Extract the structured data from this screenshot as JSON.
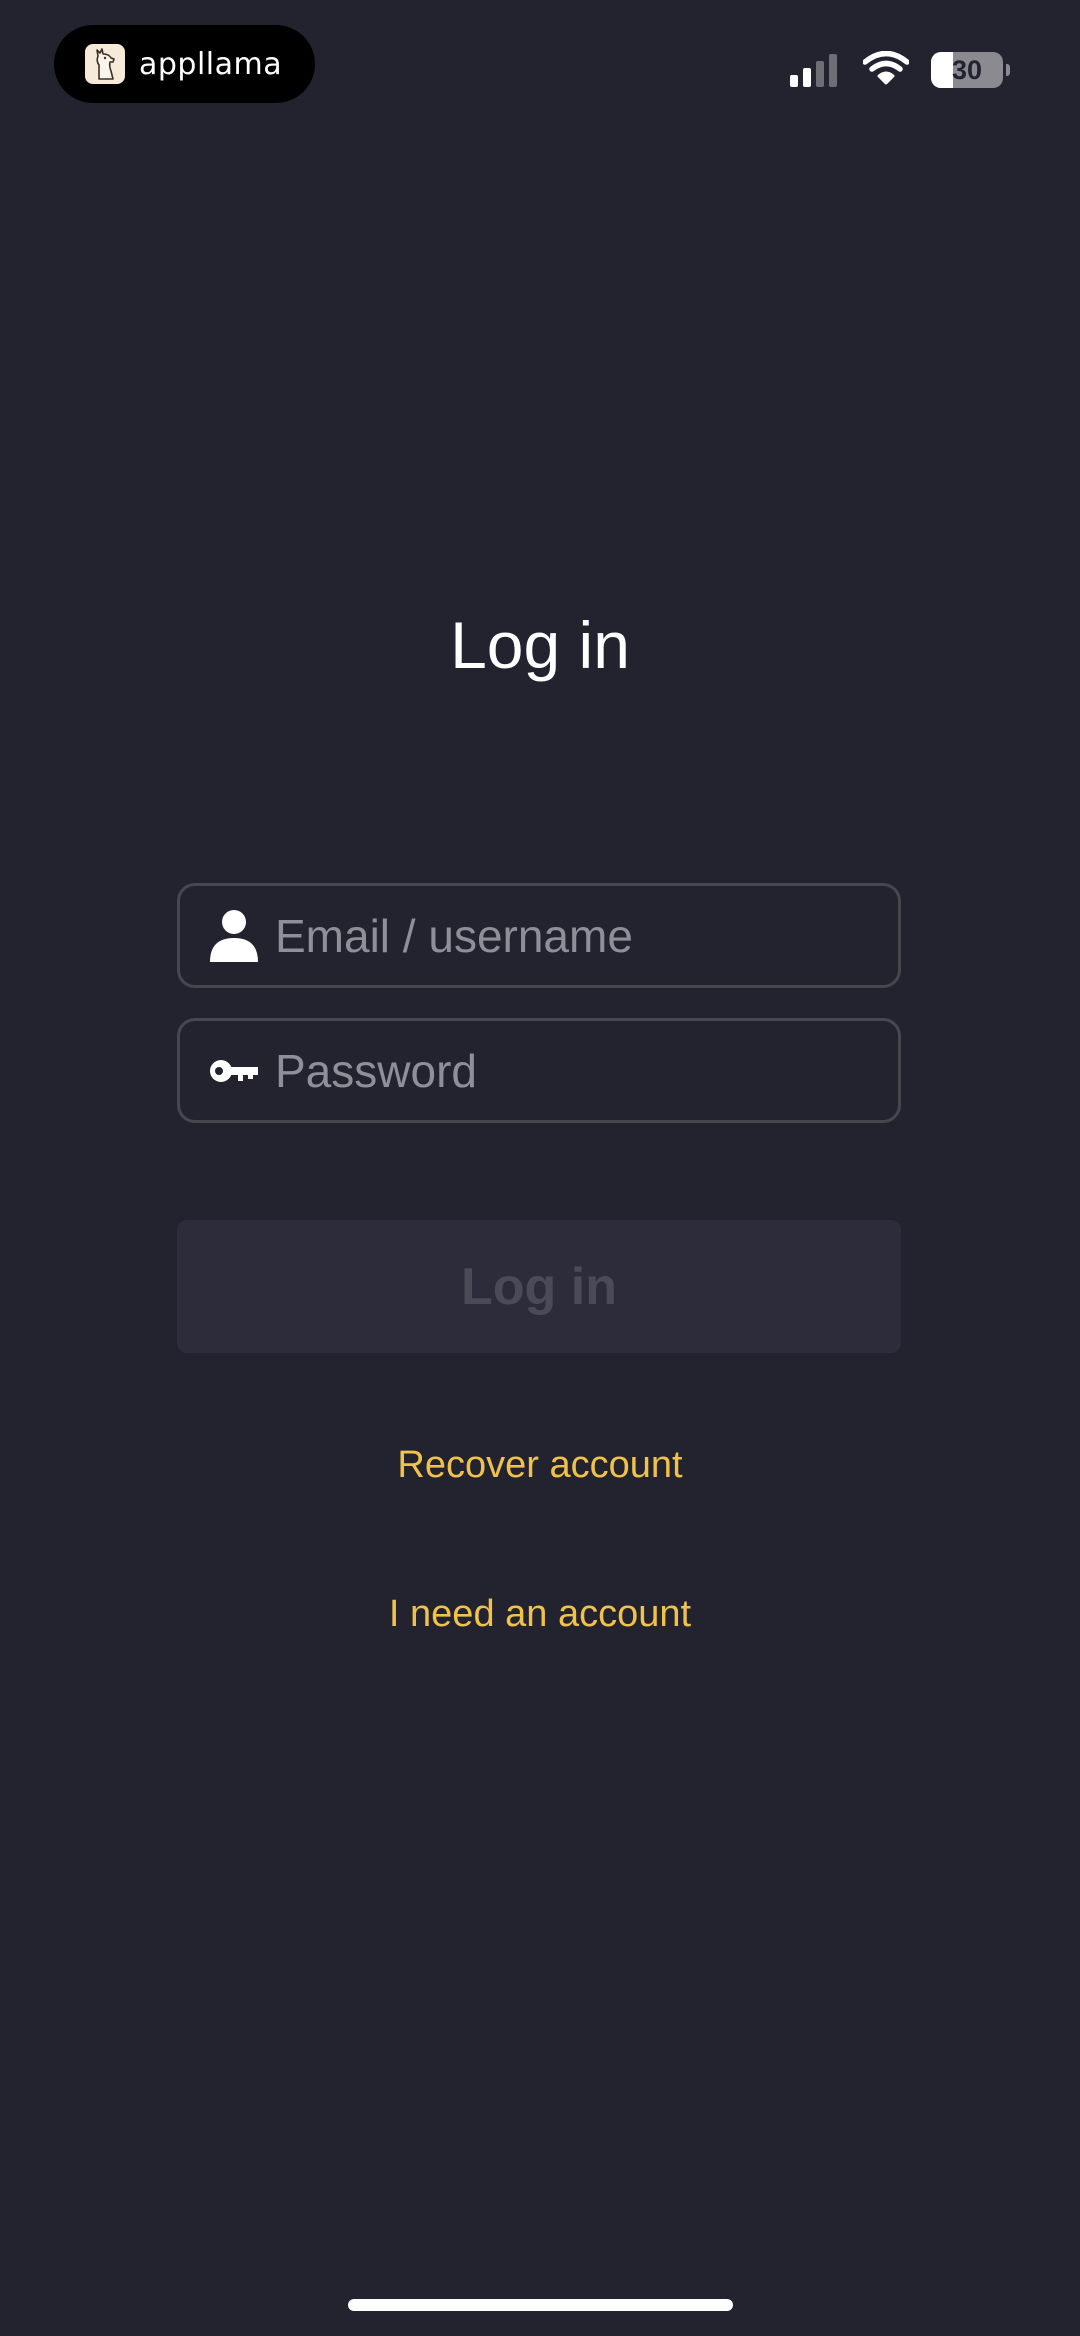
{
  "status_bar": {
    "app_name": "appllama",
    "app_icon": "llama-logo-icon",
    "battery_level": "30",
    "battery_fraction": 0.3,
    "signal_bars_active": 2,
    "signal_bars_total": 4,
    "wifi_icon": "wifi-icon"
  },
  "login": {
    "title": "Log in",
    "email_field": {
      "value": "",
      "placeholder": "Email / username",
      "icon": "person-icon"
    },
    "password_field": {
      "value": "",
      "placeholder": "Password",
      "icon": "key-icon"
    },
    "submit_label": "Log in",
    "submit_enabled": false,
    "recover_link": "Recover account",
    "signup_link": "I need an account"
  },
  "colors": {
    "background": "#22232f",
    "accent": "#f0c14b",
    "field_border": "#46474f",
    "placeholder": "#8e8f98",
    "button_disabled_bg": "#2d2c3a",
    "button_disabled_text": "#4b4b57"
  }
}
